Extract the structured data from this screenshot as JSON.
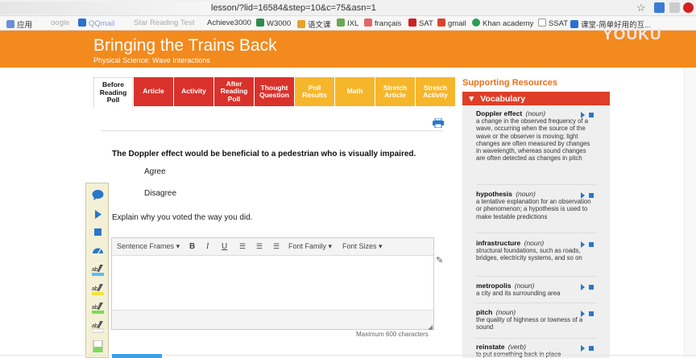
{
  "browser": {
    "url": "lesson/?lid=16584&step=10&c=75&asn=1",
    "bookmarks": [
      {
        "label": "应用",
        "color": "#6a8fd8"
      },
      {
        "label": "oogle",
        "color": ""
      },
      {
        "label": "QQmail",
        "color": "#2b6fd0"
      },
      {
        "label": "Star Reading Test",
        "color": ""
      },
      {
        "label": "Achieve3000",
        "color": ""
      },
      {
        "label": "W3000",
        "color": "#2f8c4e"
      },
      {
        "label": "语文课",
        "color": "#e7a32b"
      },
      {
        "label": "IXL",
        "color": "#6aa84f"
      },
      {
        "label": "français",
        "color": "#e06666"
      },
      {
        "label": "SAT",
        "color": "#cc2222"
      },
      {
        "label": "gmail",
        "color": "#d9442e"
      },
      {
        "label": "Khan academy",
        "color": "#2e9c56"
      },
      {
        "label": "SSAT",
        "color": "#888888"
      },
      {
        "label": "课堂-简单好用的互...",
        "color": "#2b6fd0"
      }
    ],
    "watermark": "YOUKU"
  },
  "header": {
    "title": "Bringing the Trains Back",
    "subtitle": "Physical Science: Wave Interactions",
    "color": "#f28a1e"
  },
  "tabs": [
    {
      "label": "Before Reading Poll",
      "style": "active"
    },
    {
      "label": "Article",
      "style": "red"
    },
    {
      "label": "Activity",
      "style": "red"
    },
    {
      "label": "After Reading Poll",
      "style": "red"
    },
    {
      "label": "Thought Question",
      "style": "red"
    },
    {
      "label": "Poll Results",
      "style": "yellow"
    },
    {
      "label": "Math",
      "style": "yellow"
    },
    {
      "label": "Stretch Article",
      "style": "yellow"
    },
    {
      "label": "Stretch Activity",
      "style": "yellow"
    }
  ],
  "poll": {
    "question": "The Doppler effect would be beneficial to a pedestrian who is visually impaired.",
    "options": [
      "Agree",
      "Disagree"
    ],
    "explain_prompt": "Explain why you voted the way you did."
  },
  "editor": {
    "sentence_frames": "Sentence Frames",
    "bold": "B",
    "italic": "I",
    "underline": "U",
    "font_family": "Font Family",
    "font_sizes": "Font Sizes",
    "max_chars": "Maximum 600 characters"
  },
  "resources": {
    "title": "Supporting Resources",
    "vocab_label": "Vocabulary",
    "entries": [
      {
        "word": "Doppler effect",
        "pos": "(noun)",
        "definition": "a change in the observed frequency of a wave, occurring when the source of the wave or the observer is moving;  light changes are often measured by changes in wavelength, whereas sound changes are often detected as changes in pitch"
      },
      {
        "word": "hypothesis",
        "pos": "(noun)",
        "definition": "a tentative explanation for an observation or phenomenon; a hypothesis is used to make testable predictions"
      },
      {
        "word": "infrastructure",
        "pos": "(noun)",
        "definition": "structural foundations, such as roads, bridges, electricity systems, and so on"
      },
      {
        "word": "metropolis",
        "pos": "(noun)",
        "definition": "a city and its surrounding area"
      },
      {
        "word": "pitch",
        "pos": "(noun)",
        "definition": "the quality of highness or lowness of a sound"
      },
      {
        "word": "reinstate",
        "pos": "(verb)",
        "definition": "to put something back in place"
      }
    ]
  },
  "colors": {
    "tab_red": "#d9322c",
    "tab_yellow": "#f6b62c",
    "vocab_red": "#de3e27",
    "accent_orange": "#e8711a",
    "audio_blue": "#2a77c7"
  }
}
